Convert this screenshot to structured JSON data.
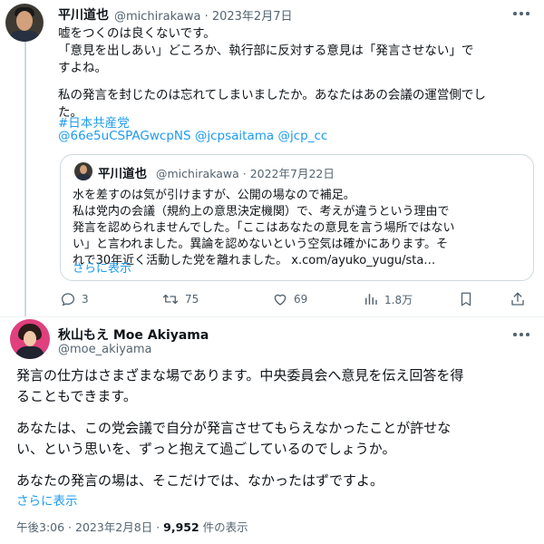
{
  "tweet1": {
    "author_name": "平川道也",
    "handle_date": "@michirakawa · 2023年2月7日",
    "lines": [
      "嘘をつくのは良くないです。",
      "「意見を出しあい」どころか、執行部に反対する意見は「発言させない」で",
      "すよね。",
      "私の発言を封じたのは忘れてしまいましたか。あなたはあの会議の運営側でし",
      "た。"
    ],
    "hashtag": "#日本共産党",
    "mention_1": "@66e5uCSPAGwcpNS",
    "mention_2": "@jcpsaitama",
    "mention_3": "@jcp_cc"
  },
  "quote": {
    "author_name": "平川道也",
    "handle_date": "@michirakawa · 2022年7月22日",
    "lines": [
      "水を差すのは気が引けますが、公開の場なので補足。",
      "私は党内の会議（規約上の意思決定機関）で、考えが違うという理由で",
      "発言を認められませんでした。「ここはあなたの意見を言う場所ではない",
      "い」と言われました。異論を認めないという空気は確かにあります。そ",
      "れで30年近く活動した党を離れました。 x.com/ayuko_yugu/sta…"
    ],
    "show_more": "さらに表示"
  },
  "actions": {
    "replies": "3",
    "retweets": "75",
    "likes": "69",
    "views": "1.8万"
  },
  "tweet2": {
    "author_name": "秋山もえ Moe Akiyama",
    "handle": "@moe_akiyama",
    "lines": [
      "発言の仕方はさまざまな場であります。中央委員会へ意見を伝え回答を得",
      "ることもできます。",
      "あなたは、この党会議で自分が発言させてもらえなかったことが許せな",
      "い、という思いを、ずっと抱えて過ごしているのでしょうか。",
      "あなたの発言の場は、そこだけでは、なかったはずですよ。"
    ],
    "show_more": "さらに表示",
    "time_date": "午後3:06 · 2023年2月8日 · ",
    "view_count": "9,952",
    "views_label": " 件の表示"
  },
  "icons": [
    "more-icon",
    "reply-icon",
    "retweet-icon",
    "like-icon",
    "views-icon",
    "bookmark-icon",
    "share-icon"
  ]
}
